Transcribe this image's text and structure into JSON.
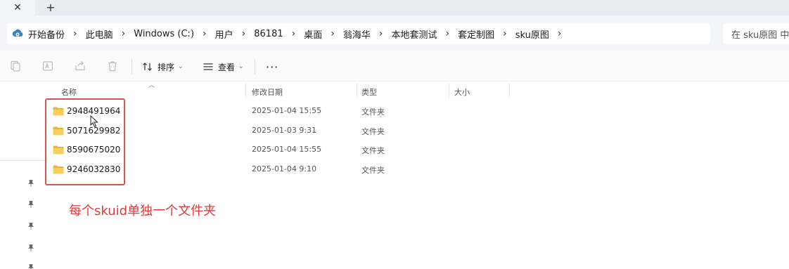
{
  "tabs": {
    "close_glyph": "✕",
    "new_tab_glyph": "+"
  },
  "breadcrumb": {
    "items": [
      "开始备份",
      "此电脑",
      "Windows (C:)",
      "用户",
      "86181",
      "桌面",
      "翁海华",
      "本地套测试",
      "套定制图",
      "sku原图"
    ],
    "icon": "cloud-backup-icon"
  },
  "search": {
    "placeholder": "在 sku原图 中"
  },
  "toolbar": {
    "sort_label": "排序",
    "view_label": "查看",
    "more_label": "···",
    "icons": [
      "copy-icon",
      "rename-icon",
      "share-icon",
      "delete-icon"
    ]
  },
  "columns": {
    "name": "名称",
    "modified": "修改日期",
    "type": "类型",
    "size": "大小"
  },
  "files": [
    {
      "name": "2948491964",
      "modified": "2025-01-04 15:55",
      "type": "文件夹"
    },
    {
      "name": "5071629982",
      "modified": "2025-01-03 9:31",
      "type": "文件夹"
    },
    {
      "name": "8590675020",
      "modified": "2025-01-04 15:55",
      "type": "文件夹"
    },
    {
      "name": "9246032830",
      "modified": "2025-01-04 9:10",
      "type": "文件夹"
    }
  ],
  "annotation": {
    "text": "每个skuid单独一个文件夹",
    "color": "#e23a3a"
  },
  "colors": {
    "folder": "#f5c542",
    "accent_red": "#d9534f"
  }
}
